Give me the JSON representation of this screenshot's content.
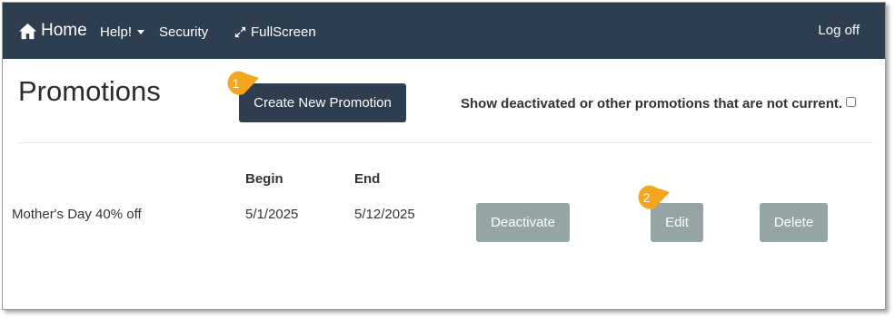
{
  "navbar": {
    "home": "Home",
    "help": "Help!",
    "security": "Security",
    "fullscreen": "FullScreen",
    "logoff": "Log off"
  },
  "page": {
    "title": "Promotions",
    "create_button": "Create New Promotion",
    "show_deactivated_label": "Show deactivated or other promotions that are not current.",
    "show_deactivated_checked": false
  },
  "table": {
    "headers": [
      "",
      "Begin",
      "End"
    ],
    "rows": [
      {
        "name": "Mother's Day 40% off",
        "begin": "5/1/2025",
        "end": "5/12/2025",
        "actions": [
          "Deactivate",
          "Edit",
          "Delete"
        ]
      }
    ]
  },
  "callouts": [
    "1",
    "2"
  ],
  "colors": {
    "navbar": "#2d3e50",
    "primary_button": "#2d3e50",
    "secondary_button": "#95a5a6",
    "callout": "#f5a61c"
  },
  "icons": {
    "home": "home-icon",
    "help": "caret-down-icon",
    "fullscreen": "expand-icon"
  }
}
